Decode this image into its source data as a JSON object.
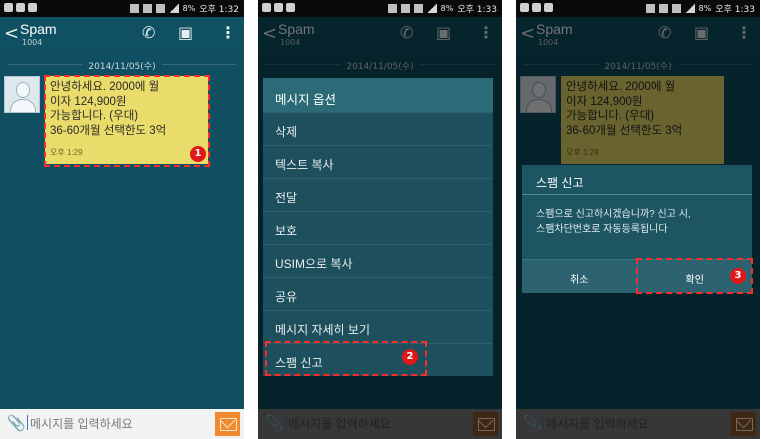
{
  "status_bar": {
    "battery": "8%",
    "time_1": "오후 1:32",
    "time_2": "오후 1:33",
    "time_3": "오후 1:33"
  },
  "header": {
    "back_label": "<",
    "title": "Spam",
    "number": "1004"
  },
  "conversation": {
    "date": "2014/11/05(수)",
    "message_lines": [
      "안녕하세요. 2000에 월",
      "이자 124,900원",
      "가능합니다. (우대)",
      "36-60개월 선택한도 3억"
    ],
    "message_time": "오후 1:29"
  },
  "input_bar": {
    "placeholder": "메시지를 입력하세요"
  },
  "menu": {
    "title": "메시지 옵션",
    "items": [
      "삭제",
      "텍스트 복사",
      "전달",
      "보호",
      "USIM으로 복사",
      "공유",
      "메시지 자세히 보기",
      "스팸 신고"
    ]
  },
  "dialog": {
    "title": "스팸 신고",
    "message_line1": "스팸으로 신고하시겠습니까? 신고 시,",
    "message_line2": "스팸차단번호로 자동등록됩니다",
    "cancel_label": "취소",
    "confirm_label": "확인"
  },
  "steps": [
    "1",
    "2",
    "3"
  ],
  "colors": {
    "highlight": "#ff2a2a",
    "bubble": "#e9dc6a",
    "header": "#0f5062",
    "send": "#f08a2e"
  }
}
